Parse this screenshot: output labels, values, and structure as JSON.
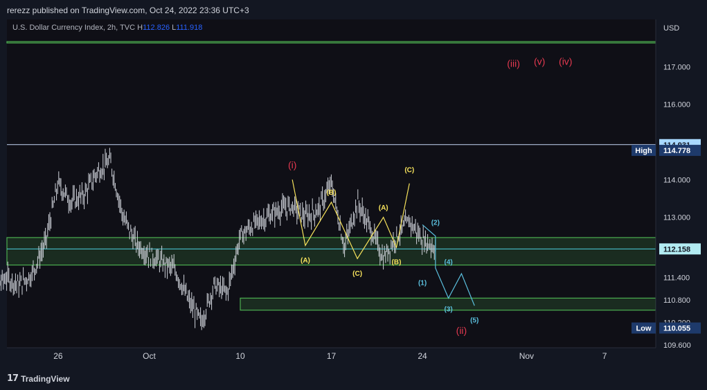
{
  "header": {
    "published_text": "rerezz published on TradingView.com, Oct 24, 2022 23:36 UTC+3"
  },
  "legend": {
    "symbol": "U.S. Dollar Currency Index, 2h, TVC",
    "h_label": "H",
    "h_value": "112.826",
    "l_label": "L",
    "l_value": "111.918"
  },
  "footer": {
    "brand": "TradingView",
    "logo_icon": "tradingview-logo-icon"
  },
  "colors": {
    "background": "#131722",
    "candle": "#d1d4dc",
    "zone": "#4caf50",
    "wave_yellow": "#f7e35c",
    "wave_cyan": "#5bc0de",
    "wave_red": "#e53950",
    "current_price_line": "#4dd0e1",
    "high_line": "#c7d7f5"
  },
  "chart_data": {
    "type": "candlestick",
    "title": "U.S. Dollar Currency Index, 2h, TVC",
    "currency": "USD",
    "ylim": [
      109.4,
      117.9
    ],
    "x_tick_labels": [
      "26",
      "Oct",
      "10",
      "17",
      "24",
      "Nov",
      "7"
    ],
    "y_tick_labels": [
      "117.000",
      "116.000",
      "114.000",
      "113.000",
      "111.400",
      "110.800",
      "110.200",
      "109.600"
    ],
    "price_tags": [
      {
        "label": "",
        "value": "114.931",
        "price": 114.931
      },
      {
        "label": "High",
        "value": "114.778",
        "price": 114.778
      },
      {
        "label": "",
        "value": "112.158",
        "price": 112.158
      },
      {
        "label": "Low",
        "value": "110.055",
        "price": 110.055
      }
    ],
    "zones": [
      {
        "from": 117.64,
        "to": 117.67
      },
      {
        "from": 111.73,
        "to": 112.46
      },
      {
        "from": 110.53,
        "to": 110.85
      }
    ],
    "horizontal_lines": [
      {
        "price": 114.931,
        "kind": "high"
      },
      {
        "price": 112.158,
        "kind": "current"
      }
    ],
    "price_path_anchors": [
      {
        "x": "Sep 20",
        "y": 110.3
      },
      {
        "x": "Sep 21",
        "y": 111.1
      },
      {
        "x": "Sep 22",
        "y": 111.4
      },
      {
        "x": "Sep 23",
        "y": 111.2
      },
      {
        "x": "Sep 24",
        "y": 111.5
      },
      {
        "x": "Sep 25",
        "y": 112.3
      },
      {
        "x": "Sep 26",
        "y": 113.9
      },
      {
        "x": "Sep 27",
        "y": 113.4
      },
      {
        "x": "Sep 28",
        "y": 113.6
      },
      {
        "x": "Sep 29",
        "y": 114.2
      },
      {
        "x": "Sep 30",
        "y": 114.5
      },
      {
        "x": "Oct 1",
        "y": 113.0
      },
      {
        "x": "Oct 2",
        "y": 112.3
      },
      {
        "x": "Oct 3",
        "y": 112.0
      },
      {
        "x": "Oct 4",
        "y": 111.8
      },
      {
        "x": "Oct 5",
        "y": 111.6
      },
      {
        "x": "Oct 6",
        "y": 110.8
      },
      {
        "x": "Oct 7",
        "y": 110.2
      },
      {
        "x": "Oct 8",
        "y": 111.2
      },
      {
        "x": "Oct 9",
        "y": 111.0
      },
      {
        "x": "Oct 10",
        "y": 112.5
      },
      {
        "x": "Oct 11",
        "y": 112.8
      },
      {
        "x": "Oct 12",
        "y": 113.0
      },
      {
        "x": "Oct 13",
        "y": 113.2
      },
      {
        "x": "Oct 14",
        "y": 113.3
      },
      {
        "x": "Oct 15",
        "y": 113.0
      },
      {
        "x": "Oct 16",
        "y": 113.2
      },
      {
        "x": "Oct 17",
        "y": 113.9
      },
      {
        "x": "Oct 18",
        "y": 112.2
      },
      {
        "x": "Oct 19",
        "y": 113.4
      },
      {
        "x": "Oct 20",
        "y": 112.7
      },
      {
        "x": "Oct 21",
        "y": 111.9
      },
      {
        "x": "Oct 22",
        "y": 112.5
      },
      {
        "x": "Oct 23",
        "y": 112.9
      },
      {
        "x": "Oct 24",
        "y": 112.4
      },
      {
        "x": "Oct 25",
        "y": 112.2
      }
    ],
    "wave_labels": [
      {
        "text": "(i)",
        "color": "red",
        "price": 114.3,
        "time": "Oct 14"
      },
      {
        "text": "(ii)",
        "color": "red",
        "price": 109.9,
        "time": "Oct 27"
      },
      {
        "text": "(iii)",
        "color": "red",
        "price": 117.0,
        "time": "Oct 31"
      },
      {
        "text": "(v)",
        "color": "red",
        "price": 117.05,
        "time": "Nov 2"
      },
      {
        "text": "(iv)",
        "color": "red",
        "price": 117.05,
        "time": "Nov 4"
      },
      {
        "text": "(A)",
        "color": "yellow",
        "price": 111.8,
        "time": "Oct 15"
      },
      {
        "text": "(B)",
        "color": "yellow",
        "price": 113.6,
        "time": "Oct 17"
      },
      {
        "text": "(C)",
        "color": "yellow",
        "price": 111.45,
        "time": "Oct 19"
      },
      {
        "text": "(A)",
        "color": "yellow",
        "price": 113.2,
        "time": "Oct 21"
      },
      {
        "text": "(B)",
        "color": "yellow",
        "price": 111.75,
        "time": "Oct 22"
      },
      {
        "text": "(C)",
        "color": "yellow",
        "price": 114.2,
        "time": "Oct 23"
      },
      {
        "text": "(1)",
        "color": "cyan",
        "price": 111.2,
        "time": "Oct 24"
      },
      {
        "text": "(2)",
        "color": "cyan",
        "price": 112.8,
        "time": "Oct 25"
      },
      {
        "text": "(3)",
        "color": "cyan",
        "price": 110.5,
        "time": "Oct 26"
      },
      {
        "text": "(4)",
        "color": "cyan",
        "price": 111.75,
        "time": "Oct 26"
      },
      {
        "text": "(5)",
        "color": "cyan",
        "price": 110.2,
        "time": "Oct 28"
      }
    ],
    "wave_paths": [
      {
        "color": "yellow",
        "points": [
          [
            114.0,
            "Oct 14"
          ],
          [
            112.25,
            "Oct 15"
          ],
          [
            113.4,
            "Oct 17"
          ],
          [
            111.9,
            "Oct 19"
          ],
          [
            113.0,
            "Oct 21"
          ],
          [
            112.2,
            "Oct 22"
          ],
          [
            113.9,
            "Oct 23"
          ]
        ]
      },
      {
        "color": "cyan",
        "points": [
          [
            112.8,
            "Oct 24"
          ],
          [
            112.5,
            "Oct 25"
          ],
          [
            111.65,
            "Oct 25"
          ],
          [
            110.85,
            "Oct 26"
          ],
          [
            111.5,
            "Oct 27"
          ],
          [
            110.65,
            "Oct 28"
          ]
        ]
      }
    ]
  }
}
